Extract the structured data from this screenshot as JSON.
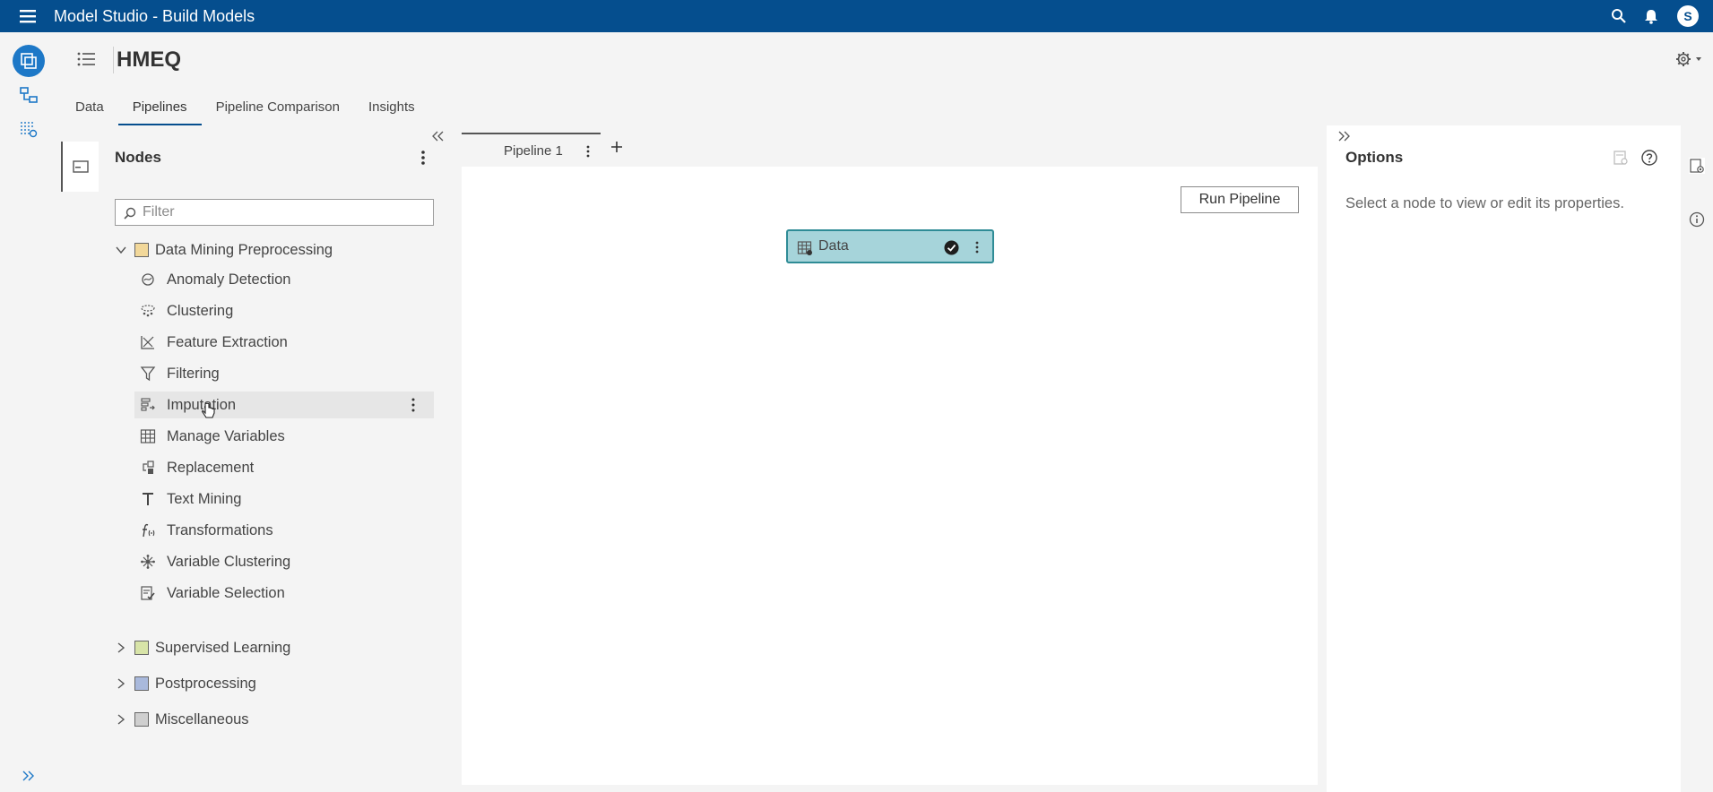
{
  "app": {
    "title": "Model Studio - Build Models",
    "user_initial": "S"
  },
  "header": {
    "project": "HMEQ"
  },
  "tabs": [
    {
      "label": "Data"
    },
    {
      "label": "Pipelines",
      "active": true
    },
    {
      "label": "Pipeline Comparison"
    },
    {
      "label": "Insights"
    }
  ],
  "nodes_panel": {
    "title": "Nodes",
    "filter_placeholder": "Filter",
    "groups": [
      {
        "label": "Data Mining Preprocessing",
        "color": "#f2d89a",
        "expanded": true,
        "items": [
          {
            "label": "Anomaly Detection",
            "icon": "anomaly-detection-icon"
          },
          {
            "label": "Clustering",
            "icon": "clustering-icon"
          },
          {
            "label": "Feature Extraction",
            "icon": "feature-extraction-icon"
          },
          {
            "label": "Filtering",
            "icon": "filter-icon"
          },
          {
            "label": "Imputation",
            "icon": "imputation-icon"
          },
          {
            "label": "Manage Variables",
            "icon": "table-grid-icon"
          },
          {
            "label": "Replacement",
            "icon": "replacement-icon"
          },
          {
            "label": "Text Mining",
            "icon": "text-icon"
          },
          {
            "label": "Transformations",
            "icon": "function-icon"
          },
          {
            "label": "Variable Clustering",
            "icon": "variable-clustering-icon"
          },
          {
            "label": "Variable Selection",
            "icon": "variable-selection-icon"
          }
        ]
      },
      {
        "label": "Supervised Learning",
        "color": "#d8e4a8",
        "expanded": false
      },
      {
        "label": "Postprocessing",
        "color": "#a9b9dc",
        "expanded": false
      },
      {
        "label": "Miscellaneous",
        "color": "#cfcfcf",
        "expanded": false
      }
    ]
  },
  "pipeline": {
    "tab_label": "Pipeline 1",
    "run_label": "Run Pipeline",
    "node": {
      "label": "Data",
      "color": "#a6d4da",
      "border": "#2f8c96",
      "status": "completed"
    }
  },
  "options_panel": {
    "title": "Options",
    "hint": "Select a node to view or edit its properties."
  },
  "colors": {
    "topbar": "#054e8e",
    "accent": "#1d78c7"
  }
}
